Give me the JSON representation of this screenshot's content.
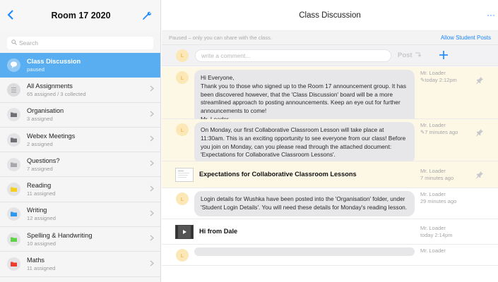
{
  "sidebar": {
    "title": "Room 17 2020",
    "search_placeholder": "Search",
    "items": [
      {
        "label": "Class Discussion",
        "sub": "paused",
        "color": "#ffffff",
        "icon": "chat-bubble-icon",
        "active": true
      },
      {
        "label": "All Assignments",
        "sub": "65 assigned / 3 collected",
        "color": "#c9c9cd",
        "icon": "list-icon"
      },
      {
        "label": "Organisation",
        "sub": "3 assigned",
        "color": "#707074",
        "icon": "folder-icon"
      },
      {
        "label": "Webex Meetings",
        "sub": "2 assigned",
        "color": "#707074",
        "icon": "folder-icon"
      },
      {
        "label": "Questions?",
        "sub": "7 assigned",
        "color": "#a8a8ac",
        "icon": "folder-icon"
      },
      {
        "label": "Reading",
        "sub": "11 assigned",
        "color": "#f5cf1f",
        "icon": "folder-icon"
      },
      {
        "label": "Writing",
        "sub": "12 assigned",
        "color": "#2c98ee",
        "icon": "folder-icon"
      },
      {
        "label": "Spelling & Handwriting",
        "sub": "10 assigned",
        "color": "#5fd24a",
        "icon": "folder-icon"
      },
      {
        "label": "Maths",
        "sub": "11 assigned",
        "color": "#ee3b30",
        "icon": "folder-icon"
      }
    ]
  },
  "main": {
    "title": "Class Discussion",
    "more": "···",
    "status_text": "Paused – only you can share with the class.",
    "allow_link": "Allow Student Posts",
    "comment_placeholder": "write a comment...",
    "post_label": "Post",
    "avatar_letter": "L"
  },
  "posts": [
    {
      "type": "comment",
      "pinned": true,
      "text": "Hi Everyone,\nThank you to those who signed up to the Room 17 announcement group. It has been discovered however, that the 'Class Discussion' board will be a more streamlined approach to posting announcements. Keep an eye out for further announcements to come!\nMr. Loader",
      "author": "Mr. Loader",
      "time": "today 2:12pm",
      "edited": true
    },
    {
      "type": "comment",
      "pinned": true,
      "text": "On Monday, our first Collaborative Classroom Lesson will take place at 11:30am. This is an exciting opportunity to see everyone from our class! Before you join on Monday, can you please read through the attached document: 'Expectations for Collaborative Classroom Lessons'.",
      "author": "Mr. Loader",
      "time": "7 minutes ago",
      "edited": true
    },
    {
      "type": "document",
      "pinned": true,
      "title": "Expectations for Collaborative Classroom Lessons",
      "author": "Mr. Loader",
      "time": "7 minutes ago"
    },
    {
      "type": "comment",
      "pinned": false,
      "text": "Login details for Wushka have been posted into the 'Organisation' folder, under 'Student Login Details'. You will need these details for Monday's reading lesson.",
      "author": "Mr. Loader",
      "time": "29 minutes ago"
    },
    {
      "type": "video",
      "pinned": false,
      "title": "Hi from Dale",
      "author": "Mr. Loader",
      "time": "today 2:14pm"
    },
    {
      "type": "comment",
      "pinned": false,
      "text": "",
      "author": "Mr. Loader",
      "time": ""
    }
  ]
}
